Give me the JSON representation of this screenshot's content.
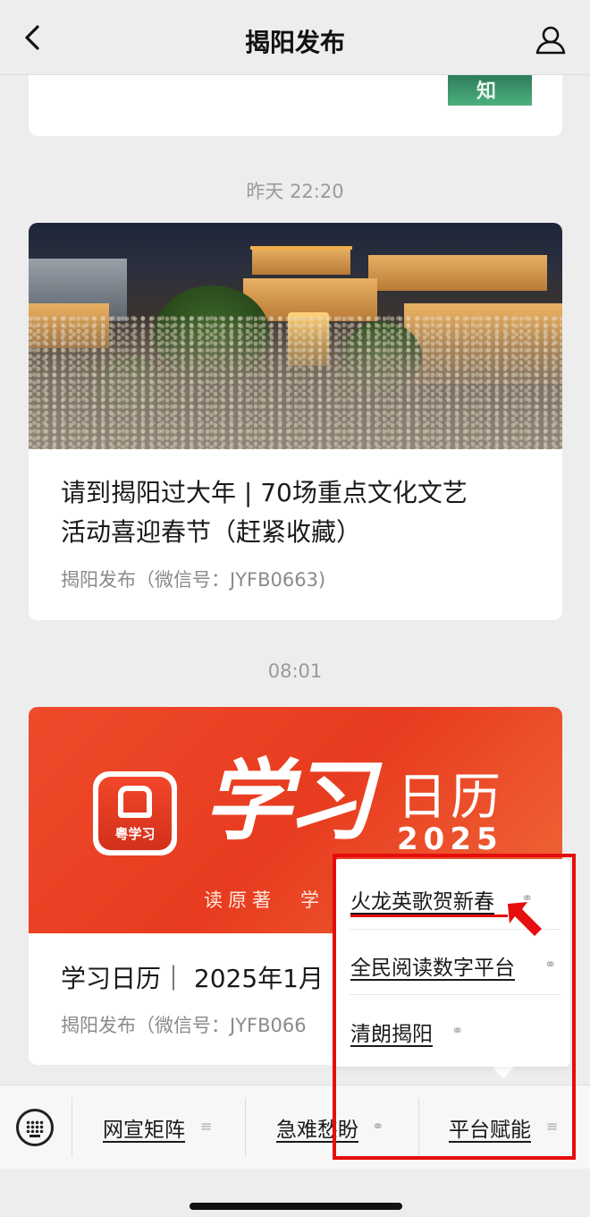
{
  "nav": {
    "title": "揭阳发布"
  },
  "feed": [
    {
      "time": "昨天 22:20",
      "title_line1": "请到揭阳过大年 | 70场重点文化文艺",
      "title_line2": "活动喜迎春节（赶紧收藏）",
      "source": "揭阳发布（微信号：JYFB0663)"
    },
    {
      "time": "08:01",
      "banner": {
        "app_name": "粤学习",
        "brush_title": "学习",
        "calendar_label": "日历",
        "year": "2025",
        "motto": "读原著　学"
      },
      "title": "学习日历｜ 2025年1月",
      "source": "揭阳发布（微信号：JYFB066"
    }
  ],
  "top_card": {
    "thumb_text": "知"
  },
  "menu": [
    {
      "label": "网宣矩阵",
      "icon": "menu-lines-icon"
    },
    {
      "label": "急难愁盼",
      "icon": "link-icon"
    },
    {
      "label": "平台赋能",
      "icon": "menu-lines-icon"
    }
  ],
  "submenu": [
    {
      "label": "火龙英歌贺新春",
      "icon": "link-icon"
    },
    {
      "label": "全民阅读数字平台",
      "icon": "link-icon"
    },
    {
      "label": "清朗揭阳",
      "icon": "link-icon"
    }
  ],
  "colors": {
    "annotation": "#e50d0d",
    "banner": "#ee4b2b"
  }
}
